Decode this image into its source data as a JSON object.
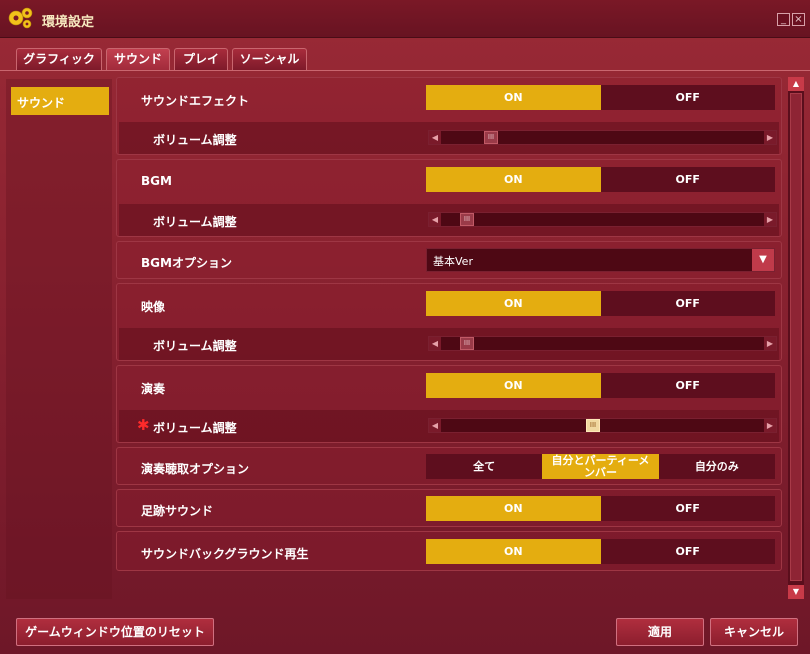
{
  "window": {
    "title": "環境設定",
    "min_glyph": "_",
    "close_glyph": "×"
  },
  "tabs": [
    {
      "label": "グラフィック"
    },
    {
      "label": "サウンド"
    },
    {
      "label": "プレイ"
    },
    {
      "label": "ソーシャル"
    }
  ],
  "active_tab": "サウンド",
  "sidebar": {
    "items": [
      {
        "label": "サウンド"
      }
    ]
  },
  "settings": {
    "sound_effect": {
      "label": "サウンドエフェクト",
      "on": "ON",
      "off": "OFF",
      "state": "ON"
    },
    "sound_effect_volume": {
      "label": "ボリューム調整",
      "thumb": "III"
    },
    "bgm": {
      "label": "BGM",
      "on": "ON",
      "off": "OFF",
      "state": "ON"
    },
    "bgm_volume": {
      "label": "ボリューム調整",
      "thumb": "III"
    },
    "bgm_option": {
      "label": "BGMオプション",
      "value": "基本Ver"
    },
    "video": {
      "label": "映像",
      "on": "ON",
      "off": "OFF",
      "state": "ON"
    },
    "video_volume": {
      "label": "ボリューム調整",
      "thumb": "III"
    },
    "performance": {
      "label": "演奏",
      "on": "ON",
      "off": "OFF",
      "state": "ON"
    },
    "performance_volume": {
      "label": "ボリューム調整",
      "marker": "✱",
      "thumb": "III"
    },
    "listen_option": {
      "label": "演奏聴取オプション",
      "options": [
        "全て",
        "自分とパーティーメ",
        "ンバー",
        "自分のみ"
      ],
      "selected": "自分とパーティーメンバー"
    },
    "footstep": {
      "label": "足跡サウンド",
      "on": "ON",
      "off": "OFF",
      "state": "ON"
    },
    "background_play": {
      "label": "サウンドバックグラウンド再生",
      "on": "ON",
      "off": "OFF",
      "state": "ON"
    }
  },
  "buttons": {
    "reset_window": "ゲームウィンドウ位置のリセット",
    "apply": "適用",
    "cancel": "キャンセル"
  },
  "arrows": {
    "left": "◀",
    "right": "▶",
    "up": "▲",
    "down": "▼",
    "caret": "▼"
  },
  "colors": {
    "accent": "#e4ad10",
    "background": "#8a2230",
    "off_bg": "#5e0e1e"
  }
}
